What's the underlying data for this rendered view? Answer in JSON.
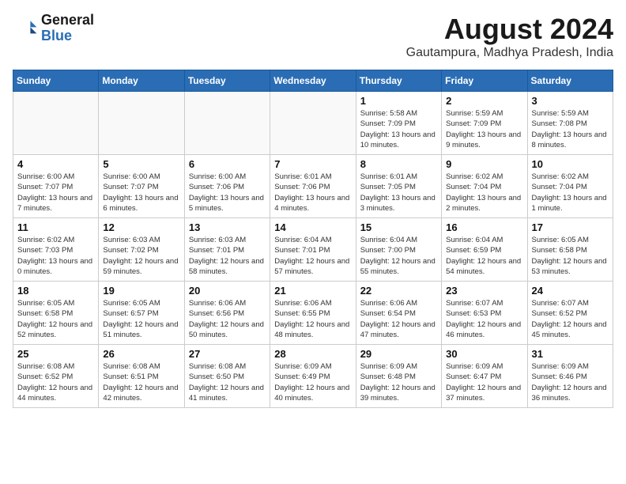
{
  "header": {
    "logo_line1": "General",
    "logo_line2": "Blue",
    "month_title": "August 2024",
    "location": "Gautampura, Madhya Pradesh, India"
  },
  "weekdays": [
    "Sunday",
    "Monday",
    "Tuesday",
    "Wednesday",
    "Thursday",
    "Friday",
    "Saturday"
  ],
  "weeks": [
    [
      {
        "day": "",
        "info": ""
      },
      {
        "day": "",
        "info": ""
      },
      {
        "day": "",
        "info": ""
      },
      {
        "day": "",
        "info": ""
      },
      {
        "day": "1",
        "info": "Sunrise: 5:58 AM\nSunset: 7:09 PM\nDaylight: 13 hours\nand 10 minutes."
      },
      {
        "day": "2",
        "info": "Sunrise: 5:59 AM\nSunset: 7:09 PM\nDaylight: 13 hours\nand 9 minutes."
      },
      {
        "day": "3",
        "info": "Sunrise: 5:59 AM\nSunset: 7:08 PM\nDaylight: 13 hours\nand 8 minutes."
      }
    ],
    [
      {
        "day": "4",
        "info": "Sunrise: 6:00 AM\nSunset: 7:07 PM\nDaylight: 13 hours\nand 7 minutes."
      },
      {
        "day": "5",
        "info": "Sunrise: 6:00 AM\nSunset: 7:07 PM\nDaylight: 13 hours\nand 6 minutes."
      },
      {
        "day": "6",
        "info": "Sunrise: 6:00 AM\nSunset: 7:06 PM\nDaylight: 13 hours\nand 5 minutes."
      },
      {
        "day": "7",
        "info": "Sunrise: 6:01 AM\nSunset: 7:06 PM\nDaylight: 13 hours\nand 4 minutes."
      },
      {
        "day": "8",
        "info": "Sunrise: 6:01 AM\nSunset: 7:05 PM\nDaylight: 13 hours\nand 3 minutes."
      },
      {
        "day": "9",
        "info": "Sunrise: 6:02 AM\nSunset: 7:04 PM\nDaylight: 13 hours\nand 2 minutes."
      },
      {
        "day": "10",
        "info": "Sunrise: 6:02 AM\nSunset: 7:04 PM\nDaylight: 13 hours\nand 1 minute."
      }
    ],
    [
      {
        "day": "11",
        "info": "Sunrise: 6:02 AM\nSunset: 7:03 PM\nDaylight: 13 hours\nand 0 minutes."
      },
      {
        "day": "12",
        "info": "Sunrise: 6:03 AM\nSunset: 7:02 PM\nDaylight: 12 hours\nand 59 minutes."
      },
      {
        "day": "13",
        "info": "Sunrise: 6:03 AM\nSunset: 7:01 PM\nDaylight: 12 hours\nand 58 minutes."
      },
      {
        "day": "14",
        "info": "Sunrise: 6:04 AM\nSunset: 7:01 PM\nDaylight: 12 hours\nand 57 minutes."
      },
      {
        "day": "15",
        "info": "Sunrise: 6:04 AM\nSunset: 7:00 PM\nDaylight: 12 hours\nand 55 minutes."
      },
      {
        "day": "16",
        "info": "Sunrise: 6:04 AM\nSunset: 6:59 PM\nDaylight: 12 hours\nand 54 minutes."
      },
      {
        "day": "17",
        "info": "Sunrise: 6:05 AM\nSunset: 6:58 PM\nDaylight: 12 hours\nand 53 minutes."
      }
    ],
    [
      {
        "day": "18",
        "info": "Sunrise: 6:05 AM\nSunset: 6:58 PM\nDaylight: 12 hours\nand 52 minutes."
      },
      {
        "day": "19",
        "info": "Sunrise: 6:05 AM\nSunset: 6:57 PM\nDaylight: 12 hours\nand 51 minutes."
      },
      {
        "day": "20",
        "info": "Sunrise: 6:06 AM\nSunset: 6:56 PM\nDaylight: 12 hours\nand 50 minutes."
      },
      {
        "day": "21",
        "info": "Sunrise: 6:06 AM\nSunset: 6:55 PM\nDaylight: 12 hours\nand 48 minutes."
      },
      {
        "day": "22",
        "info": "Sunrise: 6:06 AM\nSunset: 6:54 PM\nDaylight: 12 hours\nand 47 minutes."
      },
      {
        "day": "23",
        "info": "Sunrise: 6:07 AM\nSunset: 6:53 PM\nDaylight: 12 hours\nand 46 minutes."
      },
      {
        "day": "24",
        "info": "Sunrise: 6:07 AM\nSunset: 6:52 PM\nDaylight: 12 hours\nand 45 minutes."
      }
    ],
    [
      {
        "day": "25",
        "info": "Sunrise: 6:08 AM\nSunset: 6:52 PM\nDaylight: 12 hours\nand 44 minutes."
      },
      {
        "day": "26",
        "info": "Sunrise: 6:08 AM\nSunset: 6:51 PM\nDaylight: 12 hours\nand 42 minutes."
      },
      {
        "day": "27",
        "info": "Sunrise: 6:08 AM\nSunset: 6:50 PM\nDaylight: 12 hours\nand 41 minutes."
      },
      {
        "day": "28",
        "info": "Sunrise: 6:09 AM\nSunset: 6:49 PM\nDaylight: 12 hours\nand 40 minutes."
      },
      {
        "day": "29",
        "info": "Sunrise: 6:09 AM\nSunset: 6:48 PM\nDaylight: 12 hours\nand 39 minutes."
      },
      {
        "day": "30",
        "info": "Sunrise: 6:09 AM\nSunset: 6:47 PM\nDaylight: 12 hours\nand 37 minutes."
      },
      {
        "day": "31",
        "info": "Sunrise: 6:09 AM\nSunset: 6:46 PM\nDaylight: 12 hours\nand 36 minutes."
      }
    ]
  ]
}
